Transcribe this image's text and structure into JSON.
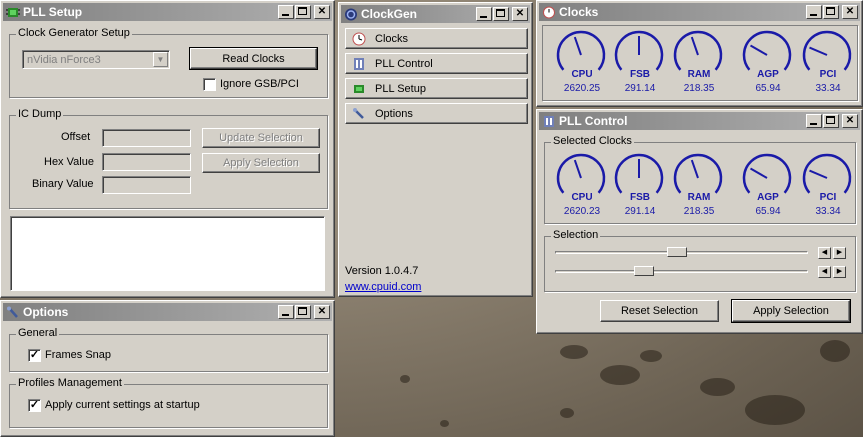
{
  "pll_setup": {
    "title": "PLL Setup",
    "clock_group": "Clock Generator Setup",
    "chipset_value": "nVidia nForce3",
    "read_clocks": "Read Clocks",
    "ignore_gsb": "Ignore GSB/PCI",
    "ic_dump_group": "IC Dump",
    "offset_label": "Offset",
    "hex_label": "Hex Value",
    "binary_label": "Binary Value",
    "update_selection": "Update Selection",
    "apply_selection": "Apply Selection"
  },
  "clockgen": {
    "title": "ClockGen",
    "items": [
      {
        "label": "Clocks",
        "icon": "clock-icon"
      },
      {
        "label": "PLL Control",
        "icon": "pll-control-icon"
      },
      {
        "label": "PLL Setup",
        "icon": "chip-icon"
      },
      {
        "label": "Options",
        "icon": "wrench-icon"
      }
    ],
    "version": "Version 1.0.4.7",
    "link": "www.cpuid.com"
  },
  "clocks": {
    "title": "Clocks",
    "gauges": [
      {
        "name": "CPU",
        "value": "2620.25",
        "level": 0.42
      },
      {
        "name": "FSB",
        "value": "291.14",
        "level": 0.5
      },
      {
        "name": "RAM",
        "value": "218.35",
        "level": 0.42
      },
      {
        "name": "AGP",
        "value": "65.94",
        "level": 0.25
      },
      {
        "name": "PCI",
        "value": "33.34",
        "level": 0.22
      }
    ]
  },
  "pll_control": {
    "title": "PLL Control",
    "selected_group": "Selected Clocks",
    "gauges": [
      {
        "name": "CPU",
        "value": "2620.23",
        "level": 0.42
      },
      {
        "name": "FSB",
        "value": "291.14",
        "level": 0.5
      },
      {
        "name": "RAM",
        "value": "218.35",
        "level": 0.42
      },
      {
        "name": "AGP",
        "value": "65.94",
        "level": 0.25
      },
      {
        "name": "PCI",
        "value": "33.34",
        "level": 0.22
      }
    ],
    "selection_group": "Selection",
    "slider1_level": 0.48,
    "slider2_level": 0.34,
    "reset_selection": "Reset Selection",
    "apply_selection": "Apply Selection"
  },
  "options": {
    "title": "Options",
    "general_group": "General",
    "frames_snap": "Frames Snap",
    "profiles_group": "Profiles Management",
    "apply_startup": "Apply current settings at startup"
  },
  "colors": {
    "gauge_blue": "#1a1aa8",
    "link": "#0000cc"
  }
}
